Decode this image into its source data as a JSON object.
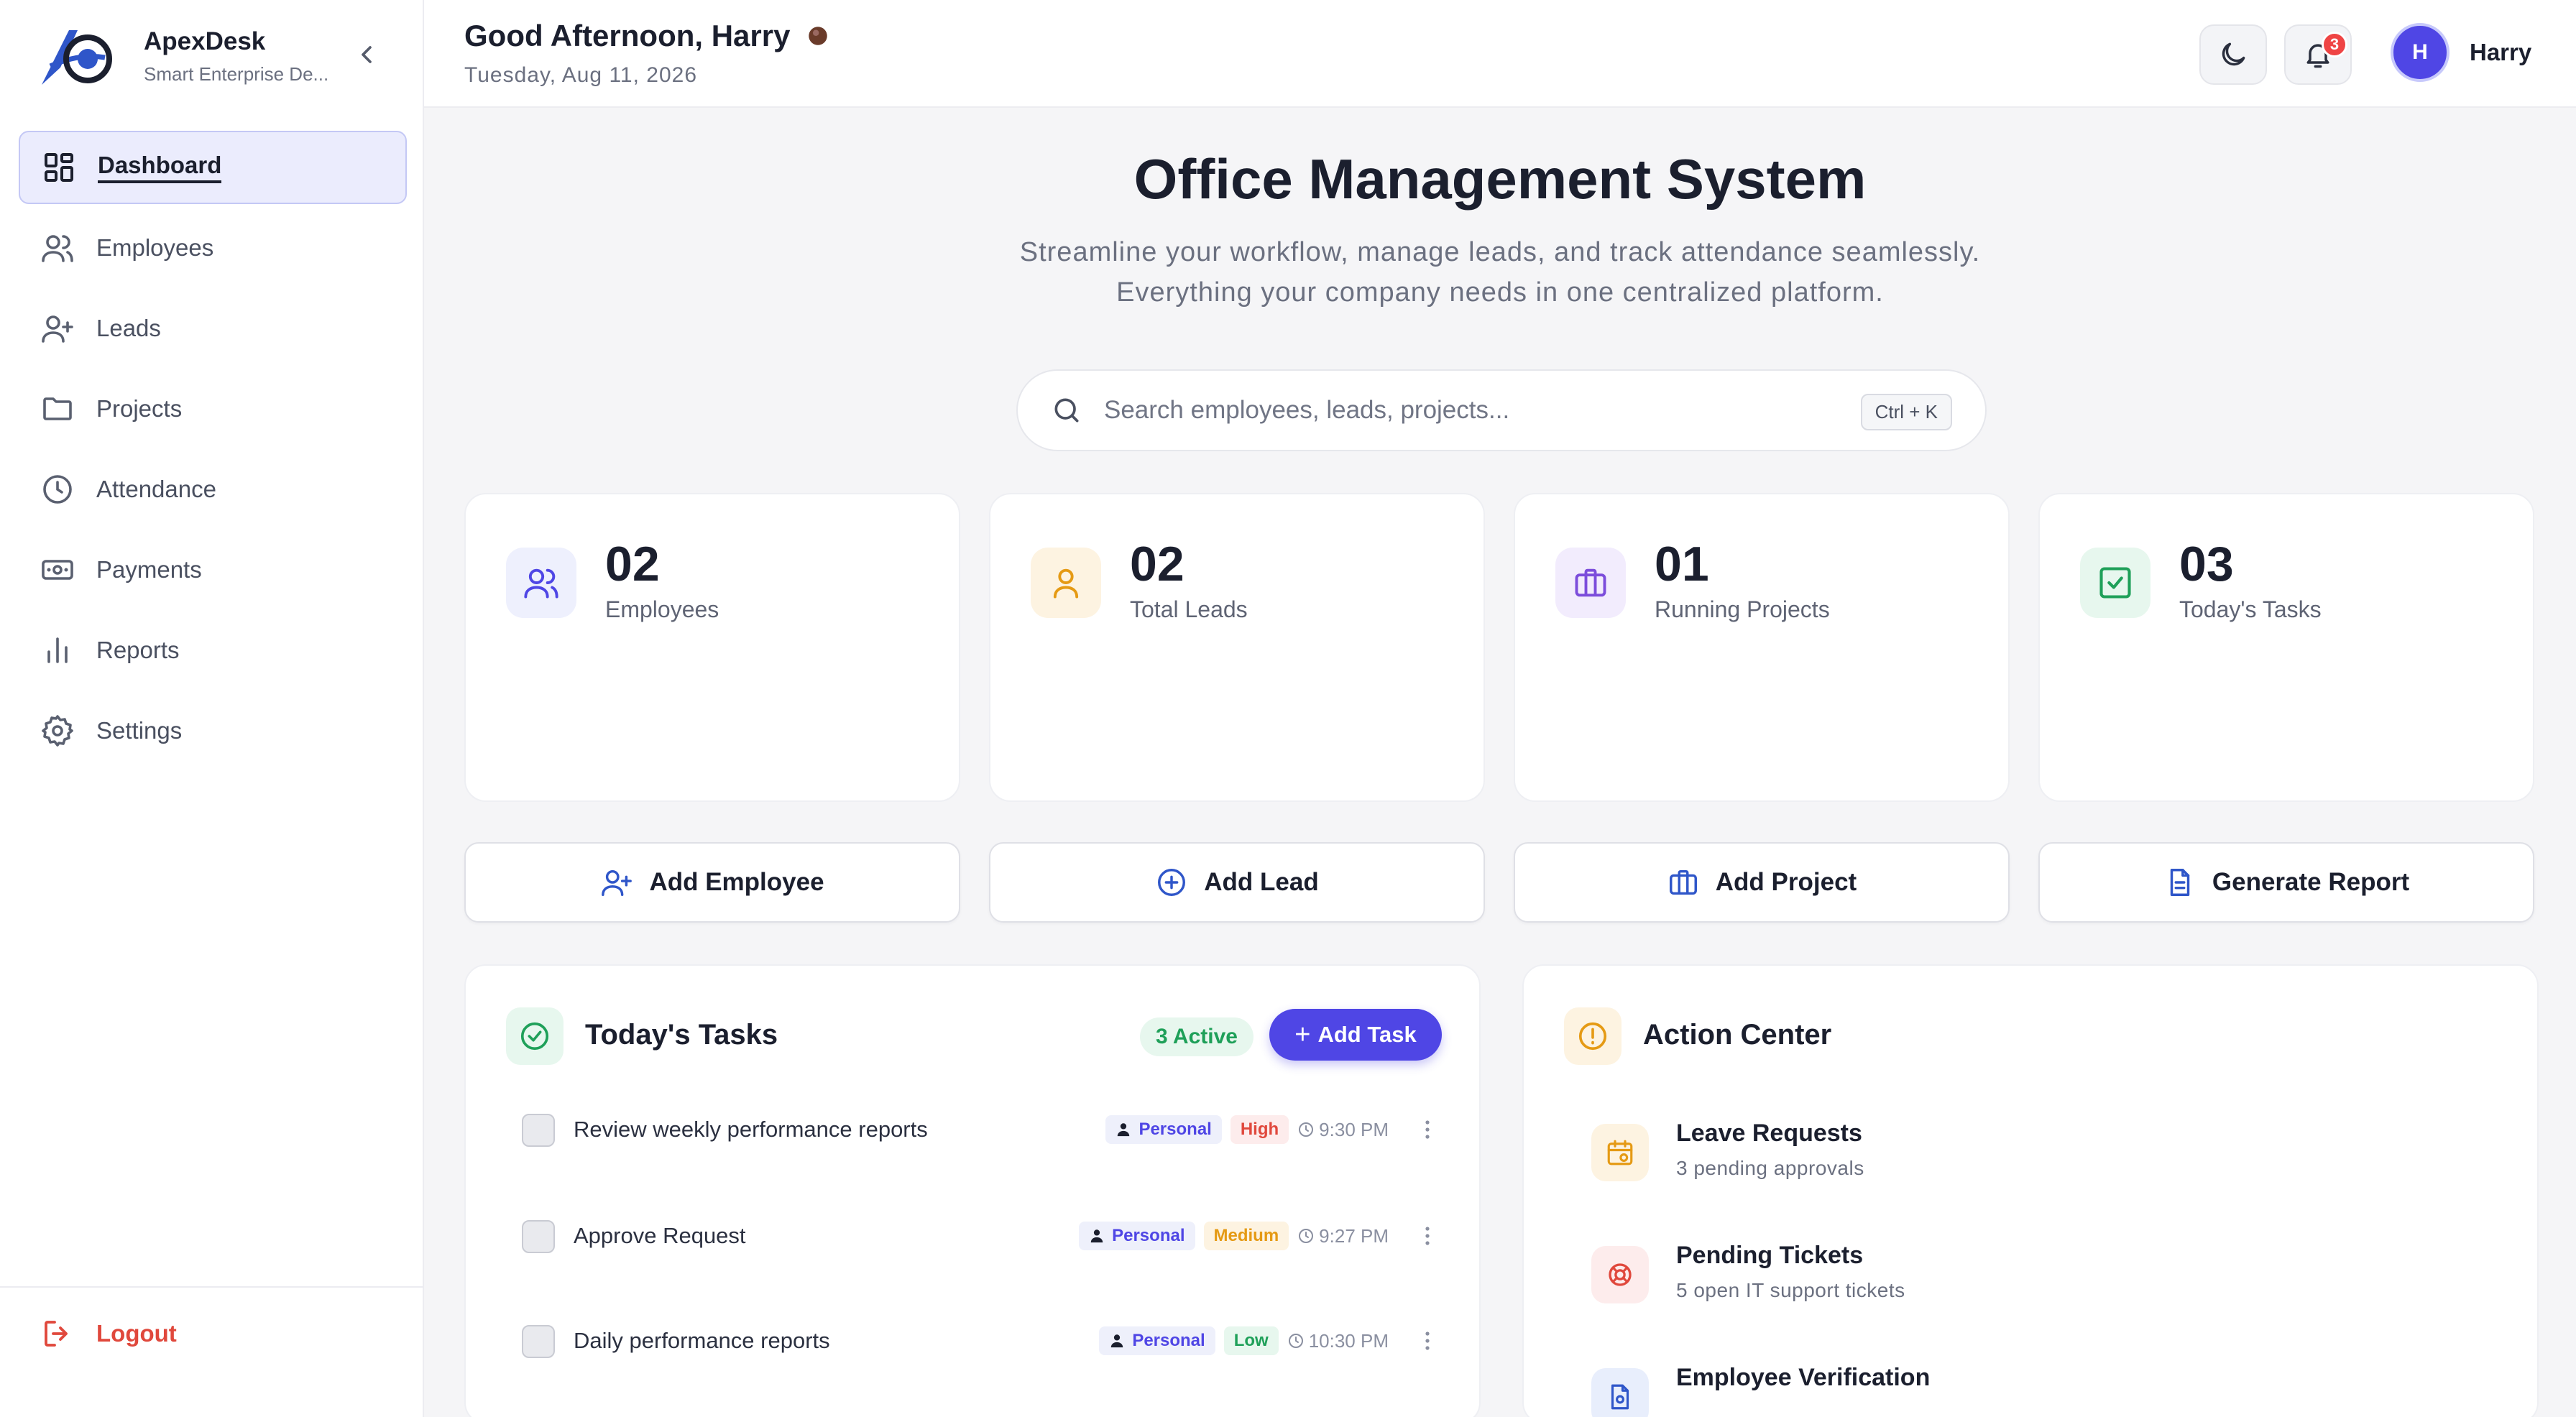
{
  "brand": {
    "name": "ApexDesk",
    "subtitle": "Smart Enterprise De..."
  },
  "nav": {
    "items": [
      {
        "label": "Dashboard",
        "icon": "dashboard-icon",
        "active": true
      },
      {
        "label": "Employees",
        "icon": "users-icon"
      },
      {
        "label": "Leads",
        "icon": "user-plus-icon"
      },
      {
        "label": "Projects",
        "icon": "folder-icon"
      },
      {
        "label": "Attendance",
        "icon": "clock-icon"
      },
      {
        "label": "Payments",
        "icon": "cash-icon"
      },
      {
        "label": "Reports",
        "icon": "bar-chart-icon"
      },
      {
        "label": "Settings",
        "icon": "gear-icon"
      }
    ],
    "logout_label": "Logout"
  },
  "header": {
    "greeting": "Good Afternoon, Harry",
    "date": "Tuesday, Aug 11, 2026",
    "notification_count": "3",
    "user_initial": "H",
    "user_name": "Harry"
  },
  "hero": {
    "title": "Office Management System",
    "subtitle_line1": "Streamline your workflow, manage leads, and track attendance seamlessly.",
    "subtitle_line2": "Everything your company needs in one centralized platform."
  },
  "search": {
    "placeholder": "Search employees, leads, projects...",
    "shortcut": "Ctrl + K"
  },
  "stats": [
    {
      "value": "02",
      "label": "Employees",
      "icon": "users-icon",
      "color": "#4f46e5",
      "bg": "#eef0fd"
    },
    {
      "value": "02",
      "label": "Total Leads",
      "icon": "user-icon",
      "color": "#e59a14",
      "bg": "#fdf3e1"
    },
    {
      "value": "01",
      "label": "Running Projects",
      "icon": "briefcase-icon",
      "color": "#7c4ddb",
      "bg": "#f2ecfd"
    },
    {
      "value": "03",
      "label": "Today's Tasks",
      "icon": "check-square-icon",
      "color": "#1fa059",
      "bg": "#e7f7ee"
    }
  ],
  "quick_actions": [
    {
      "label": "Add Employee",
      "icon": "user-plus-icon"
    },
    {
      "label": "Add Lead",
      "icon": "plus-circle-icon"
    },
    {
      "label": "Add Project",
      "icon": "briefcase-icon"
    },
    {
      "label": "Generate Report",
      "icon": "file-icon"
    }
  ],
  "tasks": {
    "title": "Today's Tasks",
    "active_badge": "3 Active",
    "add_label": "Add Task",
    "items": [
      {
        "title": "Review weekly performance reports",
        "category": "Personal",
        "priority": "High",
        "time": "9:30 PM"
      },
      {
        "title": "Approve Request",
        "category": "Personal",
        "priority": "Medium",
        "time": "9:27 PM"
      },
      {
        "title": "Daily performance reports",
        "category": "Personal",
        "priority": "Low",
        "time": "10:30 PM"
      }
    ]
  },
  "action_center": {
    "title": "Action Center",
    "items": [
      {
        "title": "Leave Requests",
        "subtitle": "3 pending approvals",
        "icon": "calendar-icon",
        "color": "#e59a14",
        "bg": "#fdf3e1"
      },
      {
        "title": "Pending Tickets",
        "subtitle": "5 open IT support tickets",
        "icon": "lifebuoy-icon",
        "color": "#e0483c",
        "bg": "#fdecec"
      },
      {
        "title": "Employee Verification",
        "subtitle": "",
        "icon": "file-icon",
        "color": "#2f56c9",
        "bg": "#e8eefc"
      }
    ]
  },
  "colors": {
    "primary": "#4f46e5",
    "danger": "#e0483c",
    "success": "#1fa059",
    "warning": "#e59a14"
  }
}
